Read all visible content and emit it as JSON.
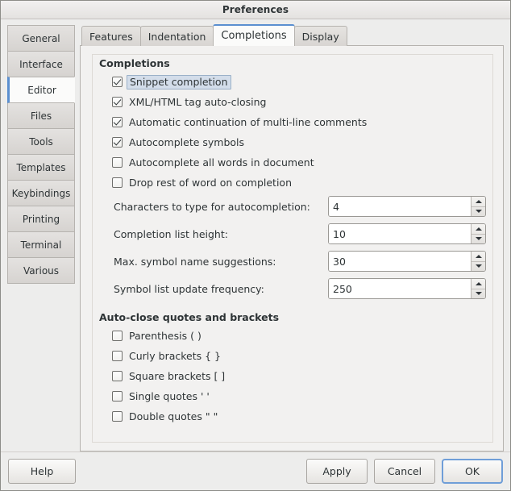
{
  "window": {
    "title": "Preferences"
  },
  "sidebar": {
    "items": [
      {
        "label": "General",
        "selected": false
      },
      {
        "label": "Interface",
        "selected": false
      },
      {
        "label": "Editor",
        "selected": true
      },
      {
        "label": "Files",
        "selected": false
      },
      {
        "label": "Tools",
        "selected": false
      },
      {
        "label": "Templates",
        "selected": false
      },
      {
        "label": "Keybindings",
        "selected": false
      },
      {
        "label": "Printing",
        "selected": false
      },
      {
        "label": "Terminal",
        "selected": false
      },
      {
        "label": "Various",
        "selected": false
      }
    ]
  },
  "tabs": [
    {
      "label": "Features",
      "selected": false
    },
    {
      "label": "Indentation",
      "selected": false
    },
    {
      "label": "Completions",
      "selected": true
    },
    {
      "label": "Display",
      "selected": false
    }
  ],
  "completions": {
    "group_title": "Completions",
    "checkboxes": [
      {
        "label": "Snippet completion",
        "checked": true,
        "focused": true
      },
      {
        "label": "XML/HTML tag auto-closing",
        "checked": true,
        "focused": false
      },
      {
        "label": "Automatic continuation of multi-line comments",
        "checked": true,
        "focused": false
      },
      {
        "label": "Autocomplete symbols",
        "checked": true,
        "focused": false
      },
      {
        "label": "Autocomplete all words in document",
        "checked": false,
        "focused": false
      },
      {
        "label": "Drop rest of word on completion",
        "checked": false,
        "focused": false
      }
    ],
    "spinners": [
      {
        "label": "Characters to type for autocompletion:",
        "value": "4"
      },
      {
        "label": "Completion list height:",
        "value": "10"
      },
      {
        "label": "Max. symbol name suggestions:",
        "value": "30"
      },
      {
        "label": "Symbol list update frequency:",
        "value": "250"
      }
    ]
  },
  "autoclose": {
    "group_title": "Auto-close quotes and brackets",
    "checkboxes": [
      {
        "label": "Parenthesis ( )",
        "checked": false
      },
      {
        "label": "Curly brackets { }",
        "checked": false
      },
      {
        "label": "Square brackets [ ]",
        "checked": false
      },
      {
        "label": "Single quotes ' '",
        "checked": false
      },
      {
        "label": "Double quotes \" \"",
        "checked": false
      }
    ]
  },
  "actions": {
    "help": "Help",
    "apply": "Apply",
    "cancel": "Cancel",
    "ok": "OK"
  },
  "colors": {
    "accent": "#5a8fd0",
    "focus_border": "#6f9ed8",
    "focus_fill": "#d3ddea",
    "window_bg": "#ededec",
    "panel_bg": "#f2f1f0",
    "text": "#2e3436"
  }
}
